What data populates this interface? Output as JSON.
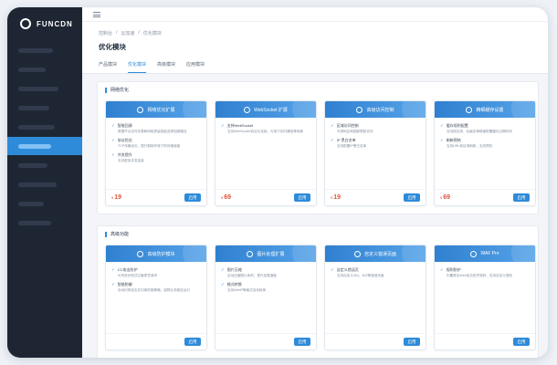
{
  "app": {
    "brand": "FUNCDN"
  },
  "sidebar": {
    "active_index": 5,
    "item_count": 10
  },
  "topbar": {
    "menu_icon": "menu-icon"
  },
  "breadcrumb": [
    "控制台",
    "/",
    "云加速",
    "/",
    "优化模块"
  ],
  "page_title": "优化模块",
  "tabs": [
    {
      "label": "产品模块",
      "active": false
    },
    {
      "label": "优化模块",
      "active": true
    },
    {
      "label": "高级模块",
      "active": false
    },
    {
      "label": "应用模块",
      "active": false
    }
  ],
  "sections": [
    {
      "title": "网络优化",
      "cards": [
        {
          "name": "网络优化扩展",
          "features": [
            {
              "title": "智能回源",
              "desc": "根据节点实时负载和网络质量智能选择回源路径"
            },
            {
              "title": "协议优化",
              "desc": "TCP传输优化，提升弱网环境下的传输速度"
            },
            {
              "title": "并发提升",
              "desc": "支持更多并发连接"
            }
          ],
          "price": "19"
        },
        {
          "name": "WebSocket 扩展",
          "features": [
            {
              "title": "支持WebSocket",
              "desc": "支持WebSocket协议长连接，可用于实时通信等场景"
            }
          ],
          "price": "69"
        },
        {
          "name": "高级访问控制",
          "features": [
            {
              "title": "区域访问控制",
              "desc": "可按地区和国家限制访问"
            },
            {
              "title": "IP 黑白名单",
              "desc": "支持配置IP黑白名单"
            }
          ],
          "price": "19"
        },
        {
          "name": "精细缓存设置",
          "features": [
            {
              "title": "缓存规则配置",
              "desc": "支持按目录、后缀名等精细配置缓存过期时间"
            },
            {
              "title": "刷新预热",
              "desc": "支持URL和目录刷新，支持预热"
            }
          ],
          "price": "69"
        }
      ]
    },
    {
      "title": "高级功能",
      "cards": [
        {
          "name": "高级防护模块",
          "features": [
            {
              "title": "CC攻击防护",
              "desc": "可有效识别并拦截恶意请求"
            },
            {
              "title": "智能防御",
              "desc": "自动识别攻击并切换防御策略，保障业务稳定运行"
            }
          ],
          "price": ""
        },
        {
          "name": "图片处理扩展",
          "features": [
            {
              "title": "图片压缩",
              "desc": "自动压缩图片体积，提升加载速度"
            },
            {
              "title": "格式转换",
              "desc": "支持WebP等格式自动转换"
            }
          ],
          "price": ""
        },
        {
          "name": "自定义错误页面",
          "features": [
            {
              "title": "自定义错误页",
              "desc": "支持自定义404、502等错误页面"
            }
          ],
          "price": ""
        },
        {
          "name": "WAF Pro",
          "features": [
            {
              "title": "规则防护",
              "desc": "内置常见Web攻击防护规则，支持自定义规则"
            }
          ],
          "price": ""
        }
      ]
    }
  ],
  "card_ui": {
    "apply_label": "启用",
    "currency": "¥"
  },
  "colors": {
    "accent": "#2e8bd9",
    "price": "#e0533d",
    "sidebar": "#1e2634"
  }
}
